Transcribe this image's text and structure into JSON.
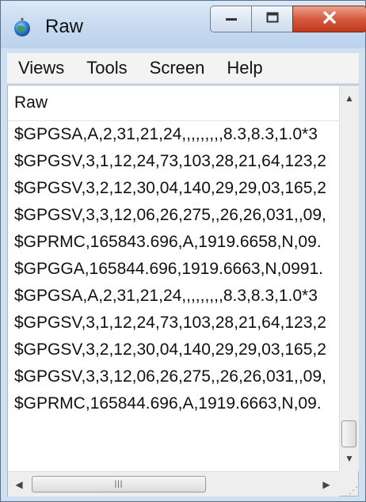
{
  "window": {
    "title": "Raw",
    "app_icon": "globe-icon",
    "controls": {
      "minimize_icon": "minimize-icon",
      "maximize_icon": "maximize-icon",
      "close_icon": "close-icon"
    }
  },
  "menubar": {
    "items": [
      "Views",
      "Tools",
      "Screen",
      "Help"
    ]
  },
  "list": {
    "header": "Raw",
    "rows": [
      "$GPGSA,A,2,31,21,24,,,,,,,,,8.3,8.3,1.0*3",
      "$GPGSV,3,1,12,24,73,103,28,21,64,123,2",
      "$GPGSV,3,2,12,30,04,140,29,29,03,165,2",
      "$GPGSV,3,3,12,06,26,275,,26,26,031,,09,",
      "$GPRMC,165843.696,A,1919.6658,N,09.",
      "$GPGGA,165844.696,1919.6663,N,0991.",
      "$GPGSA,A,2,31,21,24,,,,,,,,,8.3,8.3,1.0*3",
      "$GPGSV,3,1,12,24,73,103,28,21,64,123,2",
      "$GPGSV,3,2,12,30,04,140,29,29,03,165,2",
      "$GPGSV,3,3,12,06,26,275,,26,26,031,,09,",
      "$GPRMC,165844.696,A,1919.6663,N,09."
    ]
  },
  "colors": {
    "title_bar": "#c7daef",
    "close_button": "#d65a3f",
    "menu_background": "#f3f3f3"
  }
}
